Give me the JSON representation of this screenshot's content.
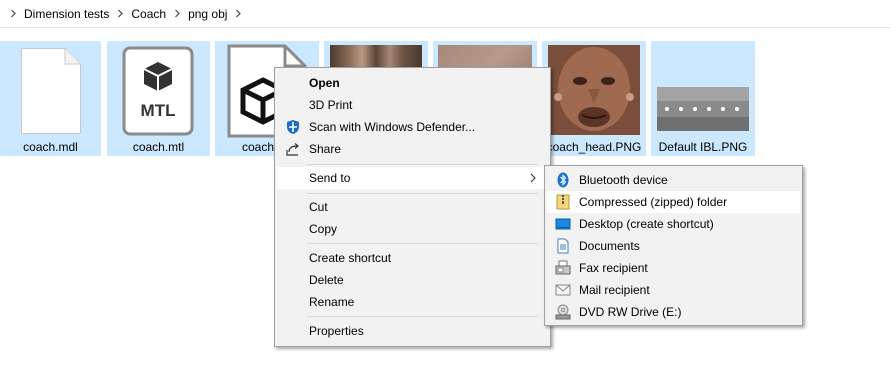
{
  "breadcrumb": {
    "items": [
      "Dimension tests",
      "Coach",
      "png obj"
    ]
  },
  "files": [
    {
      "name": "coach.mdl",
      "icon": "blank-document-icon"
    },
    {
      "name": "coach.mtl",
      "icon": "mtl-file-icon",
      "badge": "MTL"
    },
    {
      "name": "coach",
      "icon": "3d-object-file-icon"
    },
    {
      "name": "",
      "icon": "texture-thumbnail"
    },
    {
      "name": "",
      "icon": "texture-thumbnail"
    },
    {
      "name": "coach_head.PNG",
      "icon": "face-texture-thumbnail"
    },
    {
      "name": "Default IBL.PNG",
      "icon": "ibl-texture-thumbnail"
    }
  ],
  "context_menu": {
    "open": "Open",
    "print_3d": "3D Print",
    "scan": "Scan with Windows Defender...",
    "share": "Share",
    "send_to": "Send to",
    "cut": "Cut",
    "copy": "Copy",
    "create_shortcut": "Create shortcut",
    "delete": "Delete",
    "rename": "Rename",
    "properties": "Properties"
  },
  "send_to_menu": {
    "items": [
      {
        "label": "Bluetooth device",
        "icon": "bluetooth-icon"
      },
      {
        "label": "Compressed (zipped) folder",
        "icon": "zip-folder-icon"
      },
      {
        "label": "Desktop (create shortcut)",
        "icon": "desktop-icon"
      },
      {
        "label": "Documents",
        "icon": "documents-icon"
      },
      {
        "label": "Fax recipient",
        "icon": "fax-icon"
      },
      {
        "label": "Mail recipient",
        "icon": "mail-icon"
      },
      {
        "label": "DVD RW Drive (E:)",
        "icon": "dvd-drive-icon"
      }
    ]
  },
  "colors": {
    "selection": "#cce8ff",
    "menu_bg": "#f2f2f2",
    "menu_highlight": "#ffffff",
    "defender_blue": "#1e6fc4",
    "bluetooth_blue": "#1a73c9"
  }
}
